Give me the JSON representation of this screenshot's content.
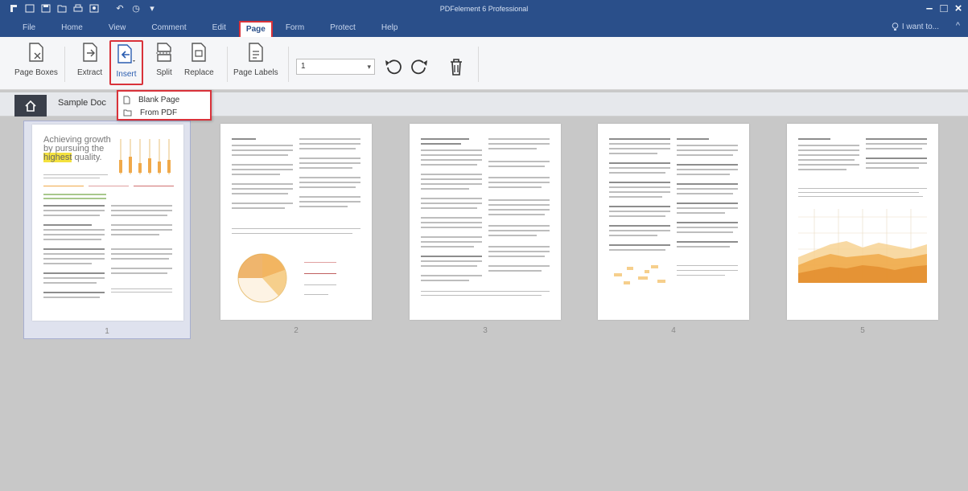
{
  "app": {
    "title": "PDFelement 6 Professional"
  },
  "quick_access": [
    "pdf-logo-icon",
    "new-icon",
    "save-icon",
    "open-icon",
    "print-icon",
    "preview-icon",
    "undo-icon",
    "redo-icon",
    "customize-icon"
  ],
  "menu": [
    {
      "label": "File"
    },
    {
      "label": "Home"
    },
    {
      "label": "View"
    },
    {
      "label": "Comment"
    },
    {
      "label": "Edit"
    },
    {
      "label": "Page",
      "active": true
    },
    {
      "label": "Form"
    },
    {
      "label": "Protect"
    },
    {
      "label": "Help"
    }
  ],
  "iwant": {
    "label": "I want to..."
  },
  "ribbon": {
    "page_boxes": "Page Boxes",
    "extract": "Extract",
    "insert": "Insert",
    "split": "Split",
    "replace": "Replace",
    "page_labels": "Page Labels",
    "page_select_value": "1"
  },
  "tabs": {
    "document": "Sample Doc"
  },
  "insert_menu": {
    "blank_page": "Blank Page",
    "from_pdf": "From PDF"
  },
  "thumbnails": [
    {
      "number": "1",
      "selected": true,
      "headline_lines": [
        "Achieving growth",
        "by pursuing the",
        "highest quality."
      ],
      "highlight_word": "highest"
    },
    {
      "number": "2"
    },
    {
      "number": "3"
    },
    {
      "number": "4"
    },
    {
      "number": "5"
    }
  ],
  "colors": {
    "title_bar": "#2a4f8a",
    "ribbon": "#f5f6f8",
    "highlight_border": "#d9323a",
    "workspace": "#c8c8c8",
    "chart_orange": "#f0a94a"
  }
}
